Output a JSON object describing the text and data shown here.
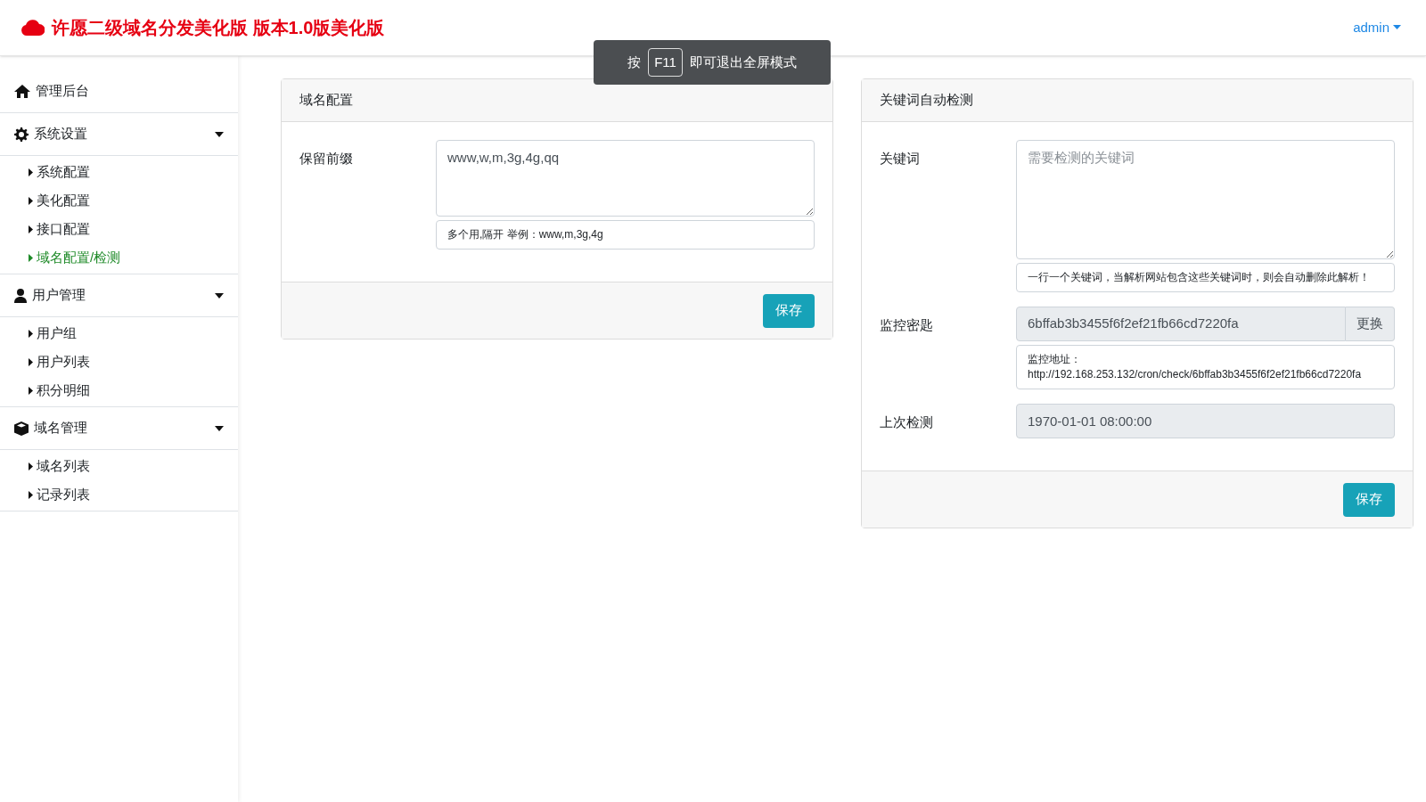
{
  "header": {
    "title": "许愿二级域名分发美化版 版本1.0版美化版",
    "user_menu": "admin"
  },
  "fullscreen_notice": {
    "prefix": "按",
    "key": "F11",
    "suffix": "即可退出全屏模式"
  },
  "sidebar": {
    "items": [
      {
        "label": "管理后台",
        "selected": false
      },
      {
        "label": "系统设置",
        "expanded": true,
        "selected": false,
        "children": [
          {
            "label": "系统配置",
            "selected": false
          },
          {
            "label": "美化配置",
            "selected": false
          },
          {
            "label": "接口配置",
            "selected": false
          },
          {
            "label": "域名配置/检测",
            "selected": true
          }
        ]
      },
      {
        "label": "用户管理",
        "expanded": true,
        "selected": false,
        "children": [
          {
            "label": "用户组",
            "selected": false
          },
          {
            "label": "用户列表",
            "selected": false
          },
          {
            "label": "积分明细",
            "selected": false
          }
        ]
      },
      {
        "label": "域名管理",
        "expanded": true,
        "selected": false,
        "children": [
          {
            "label": "域名列表",
            "selected": false
          },
          {
            "label": "记录列表",
            "selected": false
          }
        ]
      }
    ]
  },
  "cards": [
    {
      "title": "域名配置",
      "fields": [
        {
          "kind": "textarea",
          "label": "保留前缀",
          "value": "www,w,m,3g,4g,qq",
          "help": [
            "多个用,隔开 举例：www,m,3g,4g"
          ]
        }
      ],
      "button": "保存"
    },
    {
      "title": "关键词自动检测",
      "fields": [
        {
          "kind": "textarea",
          "label": "关键词",
          "placeholder": "需要检测的关键词",
          "help": [
            "一行一个关键词，当解析网站包含这些关键词时，则会自动删除此解析！"
          ]
        },
        {
          "kind": "addon",
          "label": "监控密匙",
          "value": "6bffab3b3455f6f2ef21fb66cd7220fa",
          "addon": "更换",
          "help": [
            "监控地址：",
            "http://192.168.253.132/cron/check/6bffab3b3455f6f2ef21fb66cd7220fa"
          ]
        },
        {
          "kind": "readonly",
          "label": "上次检测",
          "value": "1970-01-01 08:00:00"
        }
      ],
      "button": "保存"
    }
  ]
}
